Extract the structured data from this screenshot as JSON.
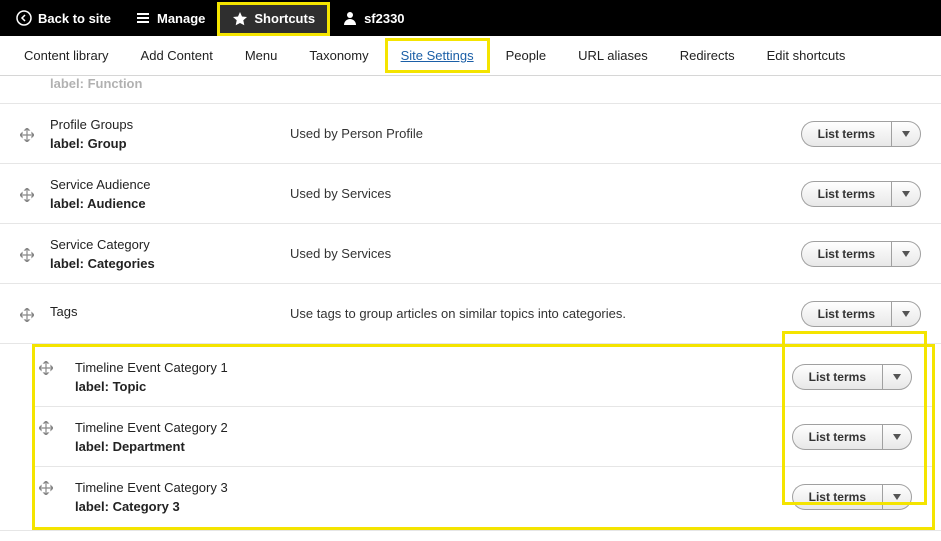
{
  "topbar": {
    "back": "Back to site",
    "manage": "Manage",
    "shortcuts": "Shortcuts",
    "user": "sf2330"
  },
  "subnav": {
    "items": [
      "Content library",
      "Add Content",
      "Menu",
      "Taxonomy",
      "Site Settings",
      "People",
      "URL aliases",
      "Redirects",
      "Edit shortcuts"
    ],
    "active_index": 4
  },
  "rows": [
    {
      "title": "",
      "label": "label: Function",
      "desc": "",
      "partial": true
    },
    {
      "title": "Profile Groups",
      "label": "label: Group",
      "desc": "Used by Person Profile"
    },
    {
      "title": "Service Audience",
      "label": "label: Audience",
      "desc": "Used by Services"
    },
    {
      "title": "Service Category",
      "label": "label: Categories",
      "desc": "Used by Services"
    },
    {
      "title": "Tags",
      "label": "",
      "desc": "Use tags to group articles on similar topics into categories."
    }
  ],
  "hl_rows": [
    {
      "title": "Timeline Event Category 1",
      "label": "label: Topic",
      "desc": ""
    },
    {
      "title": "Timeline Event Category 2",
      "label": "label: Department",
      "desc": ""
    },
    {
      "title": "Timeline Event Category 3",
      "label": "label: Category 3",
      "desc": ""
    }
  ],
  "button_label": "List terms"
}
